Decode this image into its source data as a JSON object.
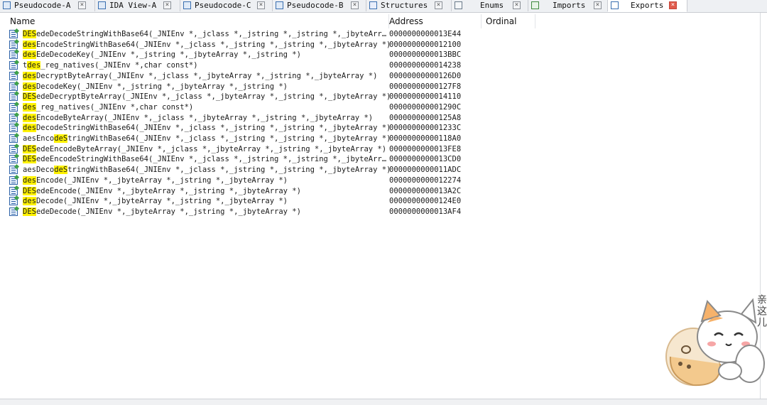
{
  "tabs": [
    {
      "label": "Pseudocode-A",
      "icon": "pseudocode-icon",
      "active": false
    },
    {
      "label": "IDA View-A",
      "icon": "ida-view-icon",
      "active": false
    },
    {
      "label": "Pseudocode-C",
      "icon": "pseudocode-icon",
      "active": false
    },
    {
      "label": "Pseudocode-B",
      "icon": "pseudocode-icon",
      "active": false
    },
    {
      "label": "Structures",
      "icon": "structures-icon",
      "active": false
    },
    {
      "label": "Enums",
      "icon": "enums-icon",
      "active": false
    },
    {
      "label": "Imports",
      "icon": "imports-icon",
      "active": false
    },
    {
      "label": "Exports",
      "icon": "exports-icon",
      "active": true
    }
  ],
  "columns": {
    "name": "Name",
    "address": "Address",
    "ordinal": "Ordinal"
  },
  "rows": [
    {
      "hl": "DES",
      "rest": "edeDecodeStringWithBase64(_JNIEnv *,_jclass *,_jstring *,_jstring *,_jbyteArr…",
      "address": "0000000000013E44"
    },
    {
      "hl": "des",
      "rest": "EncodeStringWithBase64(_JNIEnv *,_jclass *,_jstring *,_jstring *,_jbyteArray *)",
      "address": "0000000000012100"
    },
    {
      "hl": "des",
      "rest": "EdeDecodeKey(_JNIEnv *,_jstring *,_jbyteArray *,_jstring *)",
      "address": "0000000000013BBC"
    },
    {
      "pre": "t",
      "hl": "des",
      "rest": "_reg_natives(_JNIEnv *,char const*)",
      "address": "0000000000014238"
    },
    {
      "hl": "des",
      "rest": "DecryptByteArray(_JNIEnv *,_jclass *,_jbyteArray *,_jstring *,_jbyteArray *)",
      "address": "00000000000126D0"
    },
    {
      "hl": "des",
      "rest": "DecodeKey(_JNIEnv *,_jstring *,_jbyteArray *,_jstring *)",
      "address": "00000000000127F8"
    },
    {
      "hl": "DES",
      "rest": "edeDecryptByteArray(_JNIEnv *,_jclass *,_jbyteArray *,_jstring *,_jbyteArray *)",
      "address": "0000000000014110"
    },
    {
      "hl": "des",
      "rest": "_reg_natives(_JNIEnv *,char const*)",
      "address": "000000000001290C"
    },
    {
      "hl": "des",
      "rest": "EncodeByteArray(_JNIEnv *,_jclass *,_jbyteArray *,_jstring *,_jbyteArray *)",
      "address": "00000000000125A8"
    },
    {
      "hl": "des",
      "rest": "DecodeStringWithBase64(_JNIEnv *,_jclass *,_jstring *,_jstring *,_jbyteArray *)",
      "address": "000000000001233C"
    },
    {
      "pre": "aesEnco",
      "hl": "deS",
      "rest": "tringWithBase64(_JNIEnv *,_jclass *,_jstring *,_jstring *,_jbyteArray *)",
      "address": "00000000000118A0"
    },
    {
      "hl": "DES",
      "rest": "edeEncodeByteArray(_JNIEnv *,_jclass *,_jbyteArray *,_jstring *,_jbyteArray *)",
      "address": "0000000000013FE8"
    },
    {
      "hl": "DES",
      "rest": "edeEncodeStringWithBase64(_JNIEnv *,_jclass *,_jstring *,_jstring *,_jbyteArr…",
      "address": "0000000000013CD0"
    },
    {
      "pre": "aesDeco",
      "hl": "deS",
      "rest": "tringWithBase64(_JNIEnv *,_jclass *,_jstring *,_jstring *,_jbyteArray *)",
      "address": "0000000000011ADC"
    },
    {
      "hl": "des",
      "rest": "Encode(_JNIEnv *,_jbyteArray *,_jstring *,_jbyteArray *)",
      "address": "0000000000012274"
    },
    {
      "hl": "DES",
      "rest": "edeEncode(_JNIEnv *,_jbyteArray *,_jstring *,_jbyteArray *)",
      "address": "0000000000013A2C"
    },
    {
      "hl": "des",
      "rest": "Decode(_JNIEnv *,_jbyteArray *,_jstring *,_jbyteArray *)",
      "address": "00000000000124E0"
    },
    {
      "hl": "DES",
      "rest": "edeDecode(_JNIEnv *,_jbyteArray *,_jstring *,_jbyteArray *)",
      "address": "0000000000013AF4"
    }
  ],
  "sticker": {
    "icon": "cat-sticker-icon",
    "text": "亲这儿"
  },
  "colors": {
    "highlight": "#fff200",
    "active_tab_close": "#e05a4b",
    "icon_blue": "#2f63a8"
  }
}
